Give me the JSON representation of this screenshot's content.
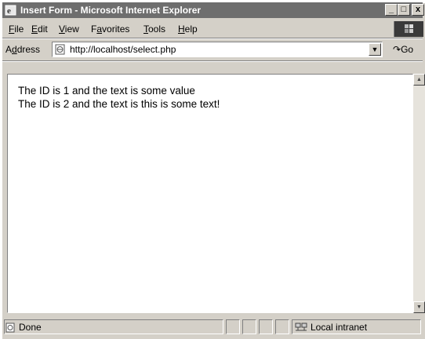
{
  "window": {
    "title": "Insert Form - Microsoft Internet Explorer",
    "controls": {
      "minimize": "_",
      "maximize": "□",
      "close": "x"
    }
  },
  "menu": {
    "items": [
      {
        "key": "F",
        "rest": "ile"
      },
      {
        "key": "E",
        "rest": "dit"
      },
      {
        "key": "V",
        "rest": "iew"
      },
      {
        "pre": "F",
        "key": "a",
        "rest": "vorites"
      },
      {
        "key": "T",
        "rest": "ools"
      },
      {
        "key": "H",
        "rest": "elp"
      }
    ]
  },
  "address": {
    "label_pre": "A",
    "label_key": "d",
    "label_rest": "dress",
    "url": "http://localhost/select.php",
    "go_label": "Go"
  },
  "content": {
    "lines": [
      "The ID is 1 and the text is some value",
      "The ID is 2 and the text is this is some text!"
    ]
  },
  "status": {
    "text": "Done",
    "zone": "Local intranet"
  },
  "icons": [
    "ie-icon",
    "windows-flag-icon",
    "page-icon",
    "dropdown-arrow-icon",
    "go-arrow-icon",
    "scroll-up-icon",
    "scroll-down-icon",
    "done-page-icon",
    "local-intranet-icon"
  ]
}
